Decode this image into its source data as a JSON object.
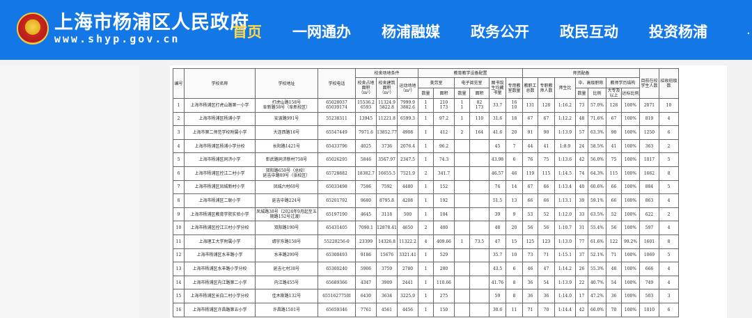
{
  "site": {
    "title_cn": "上海市杨浦区人民政府",
    "title_en": "www.shyp.gov.cn"
  },
  "nav": {
    "items": [
      "首页",
      "一网通办",
      "杨浦融媒",
      "政务公开",
      "政民互动",
      "投资杨浦"
    ],
    "active_index": 0,
    "more": "·"
  },
  "table": {
    "header_top": {
      "id": "编号",
      "name": "学校名称",
      "address": "学校地址",
      "phone": "学校电话",
      "site_group": "校舍场地条件",
      "equip_group": "教育教学设备配置",
      "staff_group": "师资配备",
      "students": "目前在校学生人数",
      "classes": "招收班级数"
    },
    "header_mid": {
      "site_area": "校舍占地面积（m²）",
      "build_area": "校舍建筑面积（m²）",
      "sport_area": "运动场地（m²）",
      "func_room": "美劳室",
      "e_room": "电子阅览室",
      "books": "图书馆生均藏书量",
      "special_classrooms": "专用教室数量",
      "staff_total": "教职工总数",
      "teachers": "专职教师人数",
      "ratio": "师生比",
      "senior": "中、高级职称",
      "edu_struct": "教师学历结构"
    },
    "header_low": {
      "count": "数量",
      "area": "面积",
      "e_count": "数量",
      "e_area": "面积",
      "senior_count": "数量",
      "senior_pct": "比例",
      "degree": "大专及以上",
      "degree_pct": "达标比例"
    },
    "rows": [
      [
        "1",
        "上海市杨浦区打虎山路第一小学",
        "打虎山路158号\n阜新路58号（阜新校区）",
        "65028037\n65039174",
        "15536.2\n6593",
        "11324.9\n5822.8",
        "7999.9\n3882.6",
        "1\n1",
        "210\n173",
        "1\n1",
        "82\n173",
        "33.7",
        "16\n10",
        "131",
        "128",
        "1:16.2",
        "73",
        "57.0%",
        "128",
        "100%",
        "2071",
        "10"
      ],
      [
        "2",
        "上海市杨浦区杨浦小学",
        "安波路991号",
        "55238311",
        "13945",
        "11221.8",
        "6599.3",
        "1",
        "97.2",
        "1",
        "110",
        "31.6",
        "18",
        "67",
        "67",
        "1:12.2",
        "48",
        "71.6%",
        "67",
        "100%",
        "819",
        "4"
      ],
      [
        "3",
        "上海市第二师范学校附属小学",
        "大连西路16号",
        "65547449",
        "7971.6",
        "13852.77",
        "4908",
        "1",
        "412",
        "2",
        "164",
        "41.6",
        "20",
        "91",
        "90",
        "1:13.9",
        "57",
        "63.3%",
        "90",
        "100%",
        "1250",
        "6"
      ],
      [
        "4",
        "上海市杨浦区杨浦小学分校",
        "长阳路1421号",
        "65433796",
        "4025",
        "3736",
        "2076.4",
        "1",
        "96.2",
        "",
        "",
        "45",
        "7",
        "44",
        "41",
        "1:8.9",
        "24",
        "58.5%",
        "41",
        "100%",
        "363",
        "2"
      ],
      [
        "5",
        "上海市杨浦区同济小学",
        "彰武路同济新村758号",
        "65026295",
        "5846",
        "3567.97",
        "2347.5",
        "1",
        "74.3",
        "",
        "",
        "43.98",
        "6",
        "76",
        "75",
        "1:13.6",
        "42",
        "56.0%",
        "75",
        "100%",
        "1017",
        "5"
      ],
      [
        "6",
        "上海市杨浦区控江二村小学",
        "双阳路650号（总校）\n延吉中路89号（张校区）",
        "65728882",
        "18382.7",
        "16655.5",
        "7521.9",
        "2",
        "341.7",
        "",
        "",
        "46.57",
        "46",
        "119",
        "115",
        "1:14.5",
        "74",
        "64.3%",
        "115",
        "100%",
        "1662",
        "8"
      ],
      [
        "7",
        "上海市杨浦区凤城新村小学",
        "凤城六村60号",
        "65033498",
        "7586",
        "7592",
        "4480",
        "1",
        "152",
        "",
        "",
        "74",
        "14",
        "67",
        "66",
        "1:13.4",
        "40",
        "60.6%",
        "66",
        "100%",
        "884",
        "5"
      ],
      [
        "8",
        "上海市杨浦区二联小学",
        "延吉中路224号",
        "65201792",
        "9680",
        "8795.8",
        "4208",
        "1",
        "192",
        "",
        "",
        "51.5",
        "13",
        "66",
        "66",
        "1:13.1",
        "39",
        "59.1%",
        "66",
        "100%",
        "863",
        "4"
      ],
      [
        "9",
        "上海市杨浦区教育学院实验小学",
        "凤城路38号（2024年9月起至五期路152号过渡）",
        "65197190",
        "4645",
        "3118",
        "500",
        "1",
        "104",
        "",
        "",
        "39",
        "9",
        "53",
        "52",
        "1:12.0",
        "33",
        "63.5%",
        "52",
        "100%",
        "622",
        "2"
      ],
      [
        "10",
        "上海市杨浦区控江三村小学分校",
        "双阳路190号",
        "65431405",
        "7090.1",
        "12878.41",
        "4650",
        "2",
        "400",
        "",
        "",
        "48",
        "20",
        "56",
        "56",
        "1:10.7",
        "31",
        "55.4%",
        "56",
        "100%",
        "597",
        "4"
      ],
      [
        "11",
        "上海理工大学附属小学",
        "靖宇东路158号",
        "55220256-0",
        "23399",
        "14326.8",
        "11322.2",
        "4",
        "409.66",
        "1",
        "73.5",
        "47",
        "15",
        "125",
        "123",
        "1:13.0",
        "77",
        "61.6%",
        "122",
        "99.2%",
        "1601",
        "8"
      ],
      [
        "12",
        "上海市杨浦区水丰路小学",
        "水丰路299号",
        "65300493",
        "9186",
        "15676",
        "3321.41",
        "1",
        "529",
        "",
        "",
        "35.7",
        "10",
        "73",
        "71",
        "1:15.1",
        "37",
        "52.1%",
        "71",
        "100%",
        "1069",
        "5"
      ],
      [
        "13",
        "上海市杨浦区水丰路小学分校",
        "延吉七村38号",
        "65300240",
        "5906",
        "3759",
        "2780",
        "1",
        "280",
        "",
        "",
        "43.5",
        "6",
        "46",
        "47",
        "1:14.2",
        "26",
        "55.3%",
        "48",
        "100%",
        "666",
        "4"
      ],
      [
        "14",
        "上海市杨浦区内江路第二小学",
        "内江路455号",
        "65689366",
        "4347",
        "3909",
        "2441",
        "1",
        "110.66",
        "",
        "",
        "41.76",
        "8",
        "36",
        "54",
        "1:13.9",
        "22",
        "40.7%",
        "54",
        "100%",
        "749",
        "4"
      ],
      [
        "15",
        "上海市杨浦区长白二村小学分校",
        "佳木斯路132号",
        "6551627750I",
        "6430",
        "3634",
        "3225.9",
        "1",
        "275",
        "",
        "",
        "59",
        "8",
        "36",
        "36",
        "1:14.0",
        "17",
        "47.2%",
        "36",
        "100%",
        "503",
        "3"
      ],
      [
        "16",
        "上海市杨浦区许昌路第五小学",
        "许昌路1501号",
        "65659346",
        "7761",
        "4561",
        "4456",
        "1",
        "150",
        "",
        "",
        "30.6",
        "11",
        "71",
        "70",
        "1:14.4",
        "42",
        "60.0%",
        "70",
        "100%",
        "1010",
        "6"
      ]
    ]
  }
}
